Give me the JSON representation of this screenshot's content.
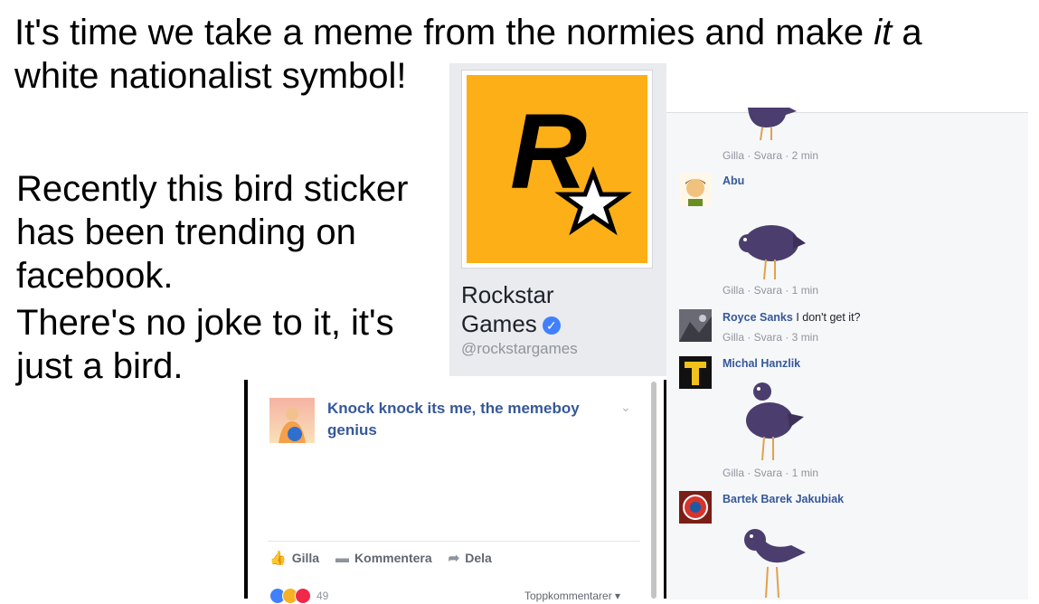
{
  "headline": {
    "part1": "It's time we take a meme from the normies and make ",
    "emphasis": "it",
    "part2": " a",
    "line2": "white nationalist symbol!"
  },
  "body": {
    "lines_a": [
      "Recently this bird sticker",
      "has been trending on",
      "facebook."
    ],
    "lines_b": [
      "There's no joke to it, it's",
      "just a bird."
    ]
  },
  "profile": {
    "name_line1": "Rockstar",
    "name_line2": "Games",
    "handle": "@rockstargames",
    "logo_color": "#fcaf17",
    "verified_icon": "check"
  },
  "post": {
    "title": "Knock knock its me, the memeboy genius",
    "actions": {
      "like": "Gilla",
      "comment": "Kommentera",
      "share": "Dela"
    },
    "reaction_count": "49",
    "sort_label": "Toppkommentarer ▾"
  },
  "comments": {
    "meta": [
      "Gilla · Svara · 2 min",
      "Gilla · Svara · 1 min",
      "Gilla · Svara · 3 min",
      "Gilla · Svara · 1 min"
    ],
    "items": [
      {
        "name": "Abu",
        "text": ""
      },
      {
        "name": "Royce Sanks",
        "text": "I don't get it?"
      },
      {
        "name": "Michal Hanzlik",
        "text": ""
      },
      {
        "name": "Bartek Barek Jakubiak",
        "text": ""
      }
    ]
  },
  "colors": {
    "link": "#365899",
    "bird": "#4b3d6e",
    "fb_bg": "#e9ebee"
  }
}
